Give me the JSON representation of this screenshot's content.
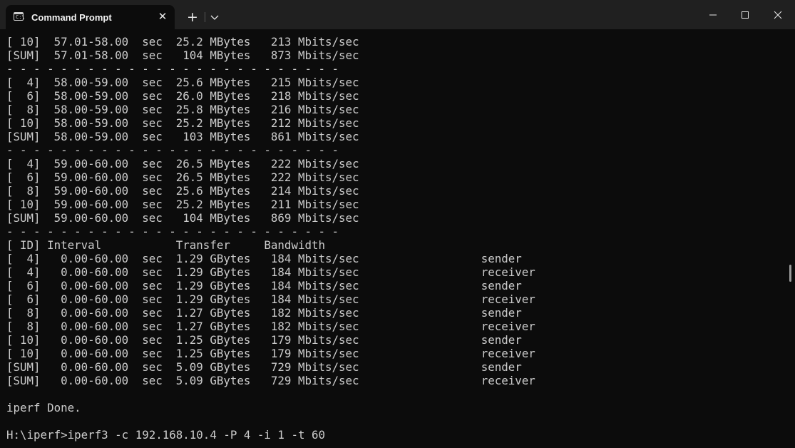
{
  "window": {
    "tab_title": "Command Prompt",
    "tab_icon_glyph": "C:\\",
    "icons": {
      "tab": "terminal-icon",
      "close_tab": "close-icon",
      "new_tab": "plus-icon",
      "dropdown": "chevron-down-icon",
      "minimize": "minimize-icon",
      "maximize": "maximize-icon",
      "close": "close-icon"
    },
    "close_tab_glyph": "✕",
    "new_tab_glyph": "+"
  },
  "colors": {
    "background": "#0c0c0c",
    "titlebar": "#202020",
    "text": "#cccccc"
  },
  "terminal": {
    "lines": [
      "[ 10]  57.01-58.00  sec  25.2 MBytes   213 Mbits/sec",
      "[SUM]  57.01-58.00  sec   104 MBytes   873 Mbits/sec",
      "- - - - - - - - - - - - - - - - - - - - - - - - -",
      "[  4]  58.00-59.00  sec  25.6 MBytes   215 Mbits/sec",
      "[  6]  58.00-59.00  sec  26.0 MBytes   218 Mbits/sec",
      "[  8]  58.00-59.00  sec  25.8 MBytes   216 Mbits/sec",
      "[ 10]  58.00-59.00  sec  25.2 MBytes   212 Mbits/sec",
      "[SUM]  58.00-59.00  sec   103 MBytes   861 Mbits/sec",
      "- - - - - - - - - - - - - - - - - - - - - - - - -",
      "[  4]  59.00-60.00  sec  26.5 MBytes   222 Mbits/sec",
      "[  6]  59.00-60.00  sec  26.5 MBytes   222 Mbits/sec",
      "[  8]  59.00-60.00  sec  25.6 MBytes   214 Mbits/sec",
      "[ 10]  59.00-60.00  sec  25.2 MBytes   211 Mbits/sec",
      "[SUM]  59.00-60.00  sec   104 MBytes   869 Mbits/sec",
      "- - - - - - - - - - - - - - - - - - - - - - - - -",
      "[ ID] Interval           Transfer     Bandwidth",
      "[  4]   0.00-60.00  sec  1.29 GBytes   184 Mbits/sec                  sender",
      "[  4]   0.00-60.00  sec  1.29 GBytes   184 Mbits/sec                  receiver",
      "[  6]   0.00-60.00  sec  1.29 GBytes   184 Mbits/sec                  sender",
      "[  6]   0.00-60.00  sec  1.29 GBytes   184 Mbits/sec                  receiver",
      "[  8]   0.00-60.00  sec  1.27 GBytes   182 Mbits/sec                  sender",
      "[  8]   0.00-60.00  sec  1.27 GBytes   182 Mbits/sec                  receiver",
      "[ 10]   0.00-60.00  sec  1.25 GBytes   179 Mbits/sec                  sender",
      "[ 10]   0.00-60.00  sec  1.25 GBytes   179 Mbits/sec                  receiver",
      "[SUM]   0.00-60.00  sec  5.09 GBytes   729 Mbits/sec                  sender",
      "[SUM]   0.00-60.00  sec  5.09 GBytes   729 Mbits/sec                  receiver",
      "",
      "iperf Done.",
      "",
      "H:\\iperf>iperf3 -c 192.168.10.4 -P 4 -i 1 -t 60"
    ]
  }
}
